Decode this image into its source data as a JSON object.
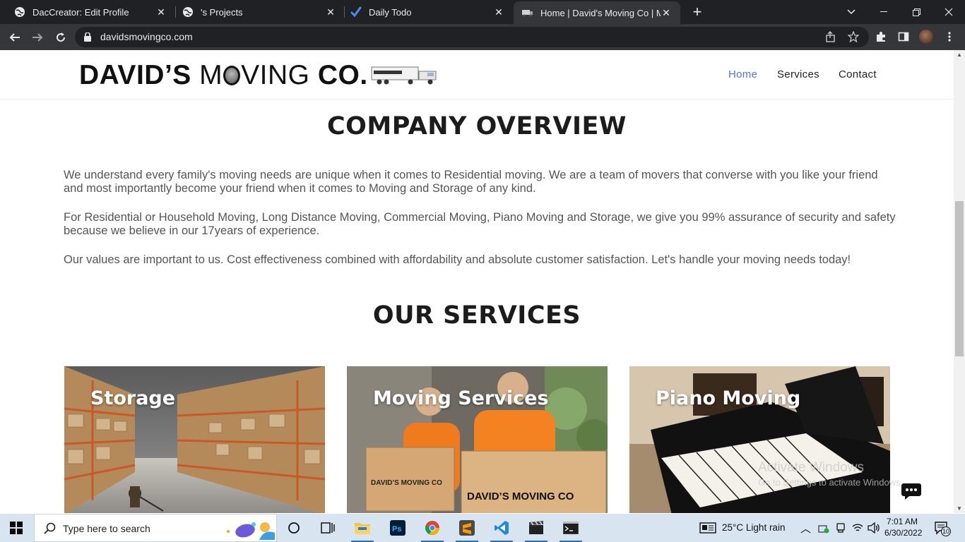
{
  "browser": {
    "tabs": [
      {
        "title": "DacCreator: Edit Profile",
        "icon": "globe-icon"
      },
      {
        "title": "'s Projects",
        "icon": "globe-icon"
      },
      {
        "title": "Daily Todo",
        "icon": "checkmark-icon"
      },
      {
        "title": "Home | David's Moving Co | Mov",
        "icon": "truck-favicon",
        "active": true
      }
    ],
    "url": "davidsmovingco.com"
  },
  "site": {
    "logo": {
      "part1": "DAVID’S",
      "part2": "M",
      "part3": "VING",
      "part4": "CO."
    },
    "nav": [
      {
        "label": "Home",
        "active": true
      },
      {
        "label": "Services"
      },
      {
        "label": "Contact"
      }
    ],
    "overview": {
      "heading": "COMPANY OVERVIEW",
      "paragraphs": [
        "We understand every family's moving needs are unique when it comes to Residential moving. We are a team of movers that converse with you like your friend and most importantly become your friend when it comes to Moving and Storage of any kind.",
        "For Residential or Household Moving, Long Distance Moving, Commercial Moving, Piano Moving and Storage, we give you 99% assurance of security and safety because we believe in our 17years of experience.",
        "Our values are important to us. Cost effectiveness combined with affordability and absolute customer satisfaction. Let's handle your moving needs today!"
      ]
    },
    "services": {
      "heading": "OUR SERVICES",
      "cards": [
        {
          "title": "Storage"
        },
        {
          "title": "Moving Services",
          "box_label": "DAVID’S MOVING CO"
        },
        {
          "title": "Piano Moving"
        }
      ]
    },
    "watermark": {
      "line1": "Activate Windows",
      "line2": "Go to Settings to activate Windows."
    }
  },
  "taskbar": {
    "search_placeholder": "Type here to search",
    "weather": "25°C  Light rain",
    "time": "7:01 AM",
    "date": "6/30/2022",
    "notifications": "10"
  },
  "colors": {
    "nav_active": "#5b6fd6",
    "heading": "#1c1c1c",
    "body_text": "#555555",
    "browser_frame": "#202124"
  }
}
